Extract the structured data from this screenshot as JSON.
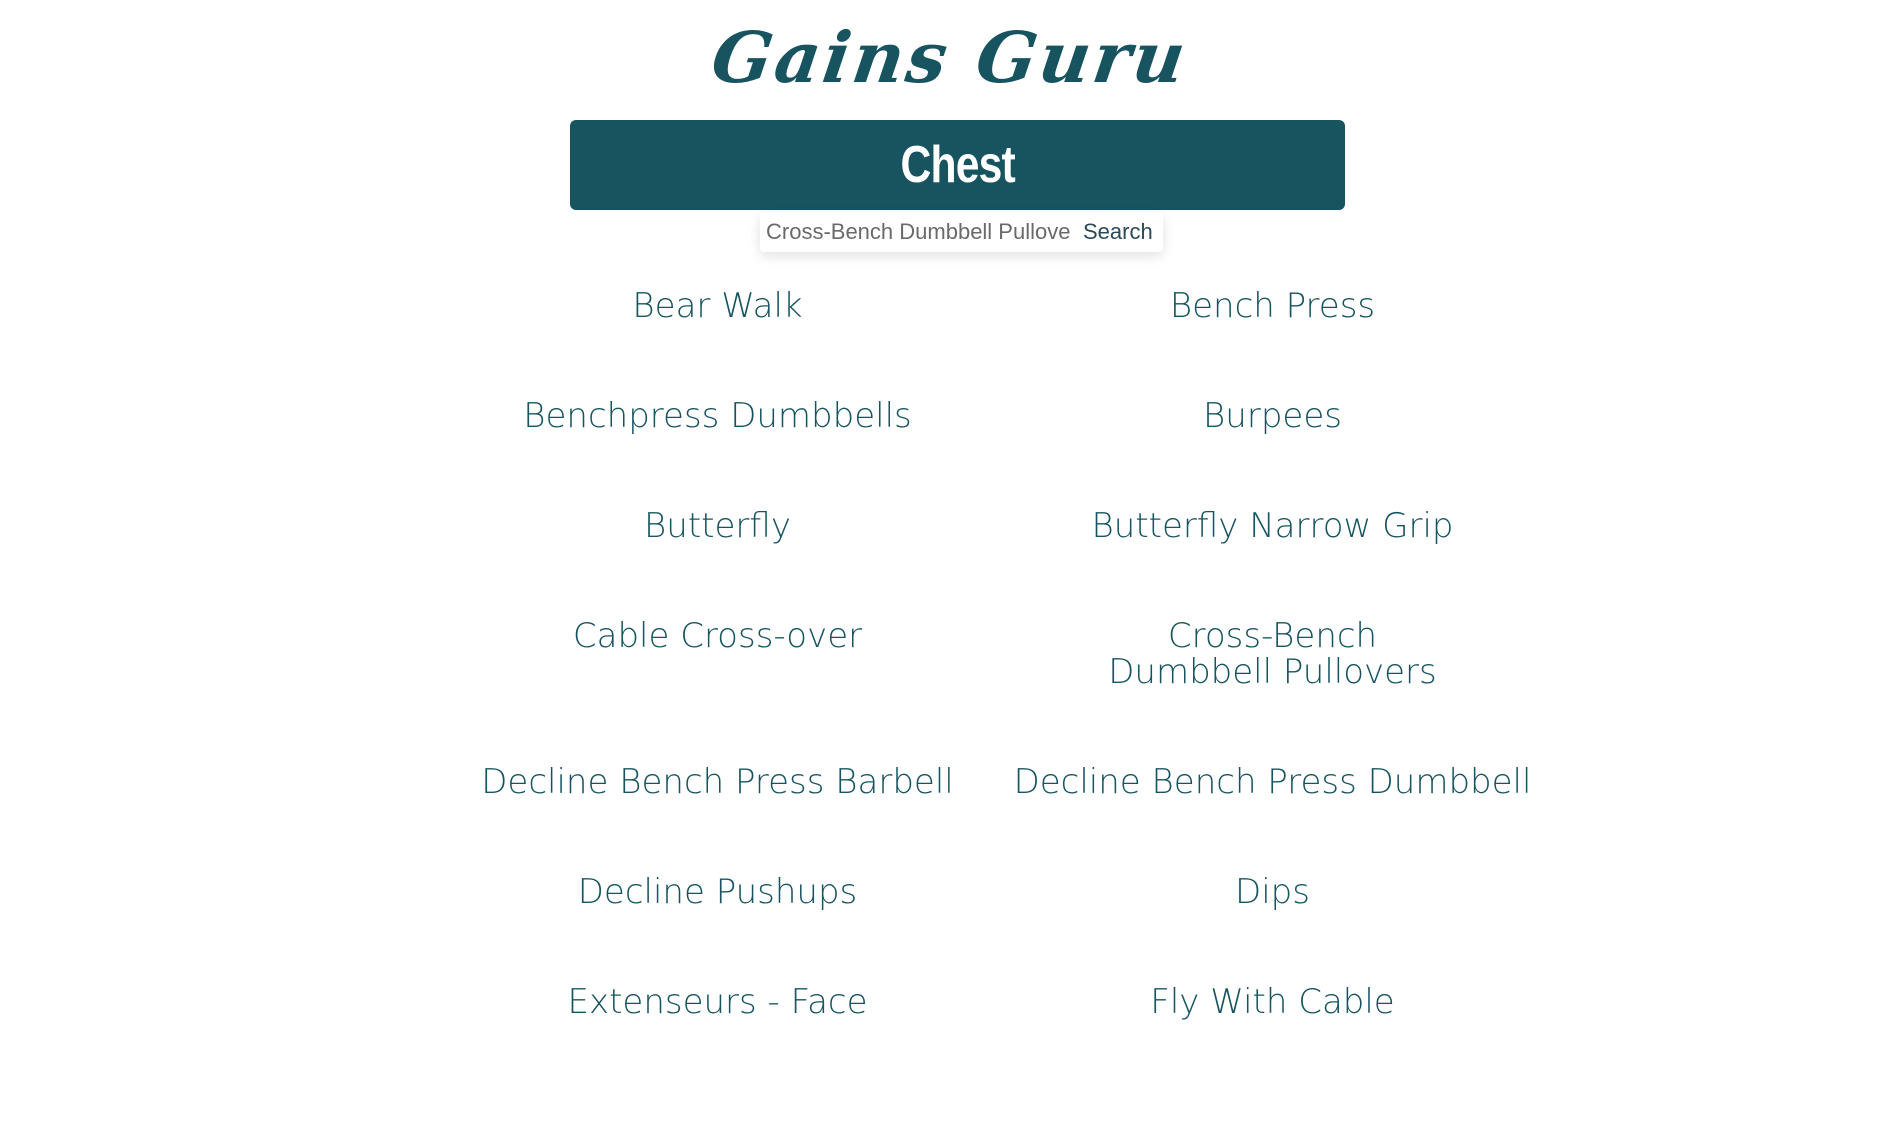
{
  "app": {
    "title": "Gains Guru"
  },
  "category": {
    "name": "Chest"
  },
  "search": {
    "value": "Cross-Bench Dumbbell Pullovers",
    "button_label": "Search"
  },
  "exercises": [
    "Bear Walk",
    "Bench Press",
    "Benchpress Dumbbells",
    "Burpees",
    "Butterfly",
    "Butterfly Narrow Grip",
    "Cable Cross-over",
    "Cross-Bench Dumbbell Pullovers",
    "Decline Bench Press Barbell",
    "Decline Bench Press Dumbbell",
    "Decline Pushups",
    "Dips",
    "Extenseurs - Face",
    "Fly With Cable"
  ],
  "colors": {
    "brand": "#175460",
    "background": "#ffffff",
    "banner_text": "#ffffff"
  }
}
